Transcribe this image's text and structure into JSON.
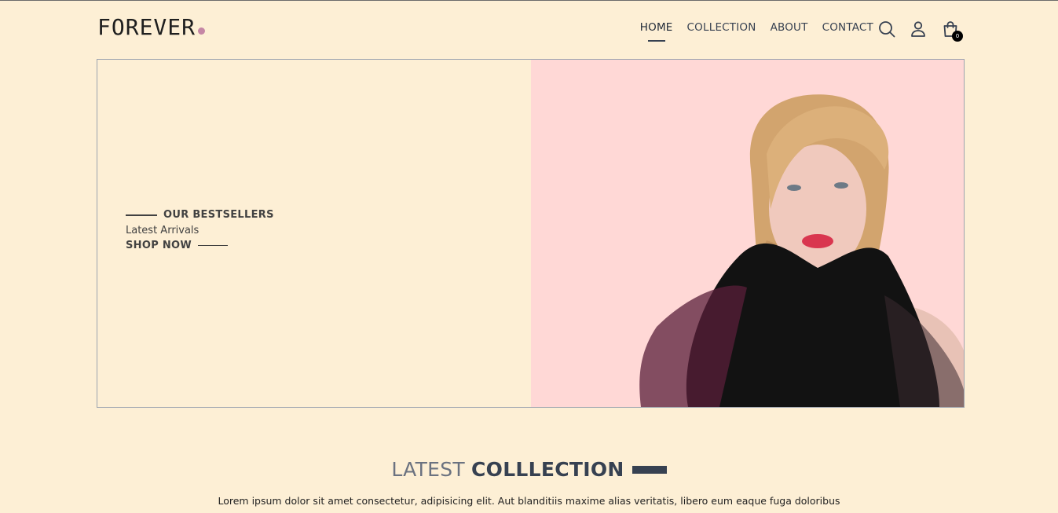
{
  "brand": {
    "name": "FOREVER",
    "dot_color": "#c586a5"
  },
  "nav": {
    "items": [
      {
        "label": "HOME",
        "active": true
      },
      {
        "label": "COLLECTION",
        "active": false
      },
      {
        "label": "ABOUT",
        "active": false
      },
      {
        "label": "CONTACT",
        "active": false
      }
    ],
    "icons": [
      "search-icon",
      "profile-icon",
      "cart-icon"
    ],
    "cart_count": "0"
  },
  "hero": {
    "tagline": "OUR BESTSELLERS",
    "subtitle": "Latest Arrivals",
    "cta": "SHOP NOW",
    "image_bg": "#ffd8d6"
  },
  "latest": {
    "title_light": "LATEST",
    "title_bold": "COLLLECTION",
    "description": "Lorem ipsum dolor sit amet consectetur, adipisicing elit. Aut blanditiis maxime alias veritatis, libero eum eaque fuga doloribus"
  },
  "colors": {
    "background": "#fdefd5",
    "text": "#374151",
    "accent": "#c586a5"
  }
}
